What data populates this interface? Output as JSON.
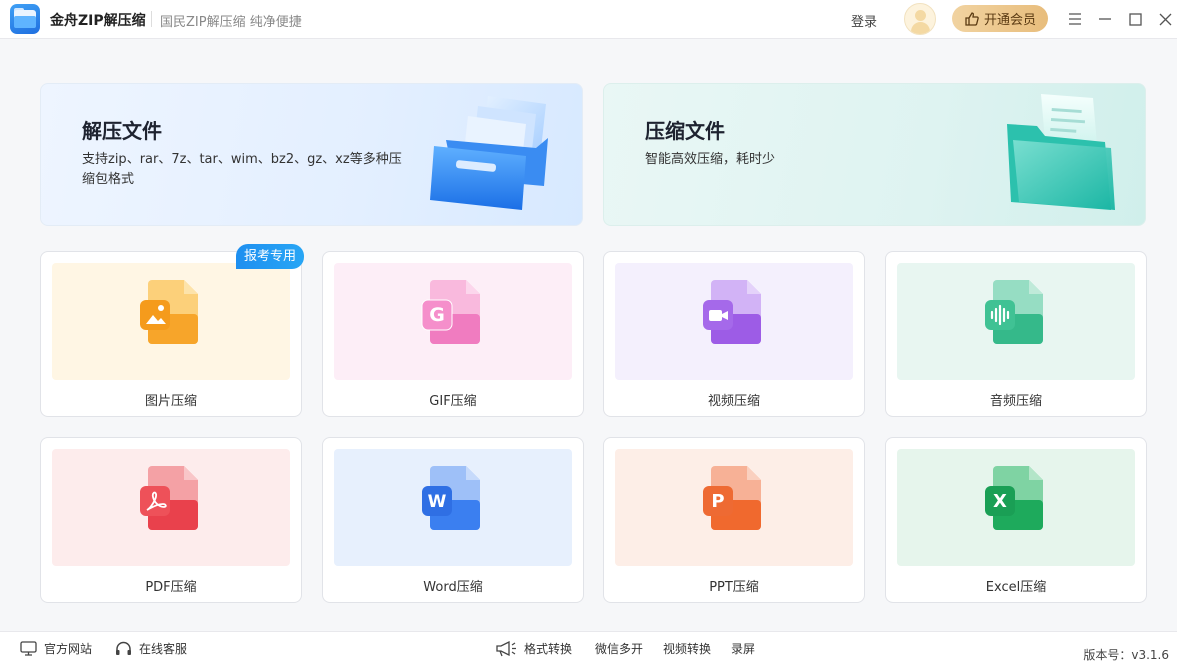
{
  "titlebar": {
    "app_name": "金舟ZIP解压缩",
    "slogan": "国民ZIP解压缩  纯净便捷",
    "login": "登录",
    "vip_button": "开通会员",
    "icons": {
      "menu": "menu-icon",
      "minimize": "minimize-icon",
      "maximize": "maximize-icon",
      "close": "close-icon"
    }
  },
  "banners": {
    "extract": {
      "title": "解压文件",
      "desc": "支持zip、rar、7z、tar、wim、bz2、gz、xz等多种压缩包格式"
    },
    "compress": {
      "title": "压缩文件",
      "desc": "智能高效压缩，耗时少"
    }
  },
  "badge": "报考专用",
  "tools": [
    {
      "label": "图片压缩",
      "icon": "image-file-icon",
      "color": "#f7a52a",
      "bg": "#fff6e4"
    },
    {
      "label": "GIF压缩",
      "icon": "gif-file-icon",
      "color": "#f07cc0",
      "bg": "#fdeef7"
    },
    {
      "label": "视频压缩",
      "icon": "video-file-icon",
      "color": "#9d5ce6",
      "bg": "#f4f0fd"
    },
    {
      "label": "音频压缩",
      "icon": "audio-file-icon",
      "color": "#35b98a",
      "bg": "#e8f6f1"
    },
    {
      "label": "PDF压缩",
      "icon": "pdf-file-icon",
      "color": "#e9414c",
      "bg": "#fdecec"
    },
    {
      "label": "Word压缩",
      "icon": "word-file-icon",
      "color": "#3b7ff0",
      "bg": "#e7f0fd"
    },
    {
      "label": "PPT压缩",
      "icon": "ppt-file-icon",
      "color": "#f0692e",
      "bg": "#fdeee7"
    },
    {
      "label": "Excel压缩",
      "icon": "excel-file-icon",
      "color": "#1eaa5c",
      "bg": "#e6f5ec"
    }
  ],
  "tool_letters": {
    "gif": "G",
    "word": "W",
    "ppt": "P",
    "excel": "X"
  },
  "statusbar": {
    "website": "官方网站",
    "support": "在线客服",
    "format_convert": "格式转换",
    "wechat_multi": "微信多开",
    "video_convert": "视频转换",
    "screen_record": "录屏",
    "version": "版本号：v3.1.6"
  }
}
